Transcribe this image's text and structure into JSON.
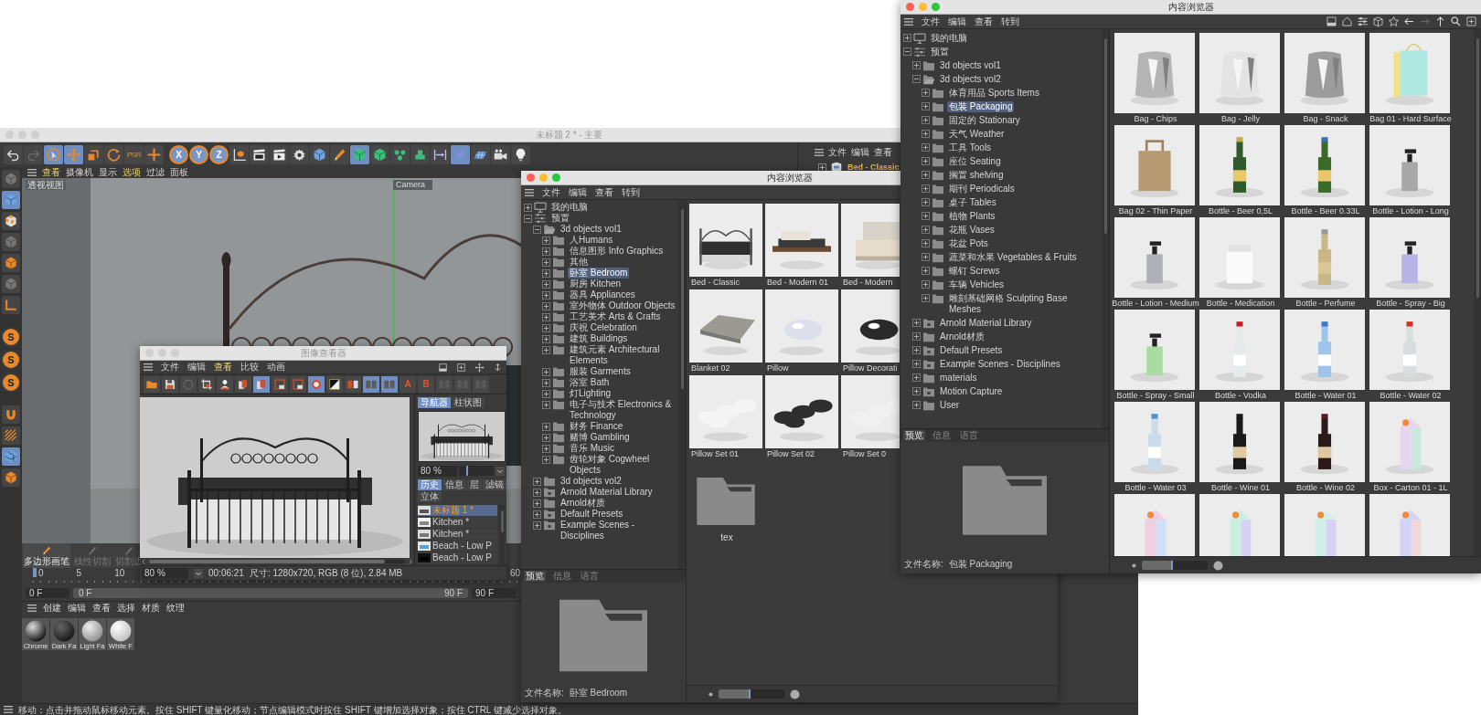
{
  "main_window": {
    "title": "未标题 2 * - 主要",
    "active": false,
    "axis_buttons": [
      {
        "label": "X",
        "on": true
      },
      {
        "label": "Y",
        "on": true
      },
      {
        "label": "Z",
        "on": true
      }
    ],
    "psr_label": "PSR",
    "viewport_menu": [
      {
        "label": "查看",
        "active": true
      },
      {
        "label": "摄像机",
        "active": false
      },
      {
        "label": "显示",
        "active": false
      },
      {
        "label": "选项",
        "active": true
      },
      {
        "label": "过滤",
        "active": false
      },
      {
        "label": "面板",
        "active": false
      }
    ],
    "viewport": {
      "view_name": "透视视图",
      "camera": "Camera"
    },
    "left_letter_buttons": [
      "S",
      "S",
      "S"
    ],
    "tool_palette": [
      {
        "label": "多边形画笔",
        "disabled": false
      },
      {
        "label": "线性切割",
        "disabled": true
      },
      {
        "label": "切割边",
        "disabled": true
      }
    ],
    "timeline": {
      "ticks": [
        "0",
        "5",
        "10"
      ],
      "end_tick": "60"
    },
    "frame_fields": {
      "start": "0 F",
      "range_start": "0 F",
      "range_end": "90 F",
      "end": "90 F",
      "level": 1
    },
    "object_manager": {
      "menu": [
        "文件",
        "编辑",
        "查看"
      ],
      "object": "Bed - Classic"
    },
    "material_manager": {
      "menu": [
        "创建",
        "编辑",
        "查看",
        "选择",
        "材质",
        "纹理"
      ],
      "materials": [
        "Chrome",
        "Dark Fa",
        "Light Fa",
        "White F"
      ]
    },
    "status_bar": "移动：点击并拖动鼠标移动元素。按住 SHIFT 键量化移动；节点编辑模式时按住 SHIFT 键增加选择对象；按住 CTRL 键减少选择对象。"
  },
  "image_viewer": {
    "title": "图像查看器",
    "active": false,
    "menu": [
      {
        "label": "文件",
        "active": false
      },
      {
        "label": "编辑",
        "active": false
      },
      {
        "label": "查看",
        "active": true
      },
      {
        "label": "比较",
        "active": false
      },
      {
        "label": "动画",
        "active": false
      }
    ],
    "compare_buttons": [
      "A",
      "B"
    ],
    "panel_tabs": [
      {
        "label": "导航器",
        "selected": true
      },
      {
        "label": "柱状图",
        "selected": false
      }
    ],
    "zoom_slider": {
      "value": "80 %",
      "level": 0.2
    },
    "history_tabs": [
      {
        "label": "历史",
        "selected": true
      },
      {
        "label": "信息",
        "selected": false
      },
      {
        "label": "层",
        "selected": false
      },
      {
        "label": "滤镜",
        "selected": false
      },
      {
        "label": "立体",
        "selected": false
      }
    ],
    "history": [
      {
        "label": "未标题 1 *",
        "selected": true
      },
      {
        "label": "Kitchen *",
        "selected": false
      },
      {
        "label": "Kitchen *",
        "selected": false
      },
      {
        "label": "Beach - Low P",
        "selected": false
      },
      {
        "label": "Beach - Low P",
        "selected": false
      }
    ],
    "status": {
      "zoom": "80 %",
      "time": "00:06:21",
      "info": "尺寸: 1280x720, RGB (8 位), 2.84 MB"
    }
  },
  "content_browsers": [
    {
      "title": "内容浏览器",
      "active": true,
      "menu": [
        "文件",
        "编辑",
        "查看",
        "转到"
      ],
      "tree": [
        {
          "label": "我的电脑",
          "kind": "computer",
          "expanded": false,
          "selected": false
        },
        {
          "label": "预置",
          "kind": "presets",
          "expanded": true,
          "selected": false,
          "children": [
            {
              "label": "3d objects vol1",
              "kind": "folder",
              "expanded": true,
              "selected": false,
              "children": [
                {
                  "label": "人Humans",
                  "kind": "folder",
                  "expanded": false,
                  "selected": false
                },
                {
                  "label": "信息图形 Info Graphics",
                  "kind": "folder",
                  "expanded": false,
                  "selected": false
                },
                {
                  "label": "其他",
                  "kind": "folder",
                  "expanded": false,
                  "selected": false
                },
                {
                  "label": "卧室 Bedroom",
                  "kind": "folder",
                  "expanded": false,
                  "selected": true
                },
                {
                  "label": "厨房 Kitchen",
                  "kind": "folder",
                  "expanded": false,
                  "selected": false
                },
                {
                  "label": "器具 Appliances",
                  "kind": "folder",
                  "expanded": false,
                  "selected": false
                },
                {
                  "label": "室外物体 Outdoor Objects",
                  "kind": "folder",
                  "expanded": false,
                  "selected": false
                },
                {
                  "label": "工艺美术 Arts & Crafts",
                  "kind": "folder",
                  "expanded": false,
                  "selected": false
                },
                {
                  "label": "庆祝 Celebration",
                  "kind": "folder",
                  "expanded": false,
                  "selected": false
                },
                {
                  "label": "建筑 Buildings",
                  "kind": "folder",
                  "expanded": false,
                  "selected": false
                },
                {
                  "label": "建筑元素 Architectural Elements",
                  "kind": "folder",
                  "expanded": false,
                  "selected": false
                },
                {
                  "label": "服装 Garments",
                  "kind": "folder",
                  "expanded": false,
                  "selected": false
                },
                {
                  "label": "浴室 Bath",
                  "kind": "folder",
                  "expanded": false,
                  "selected": false
                },
                {
                  "label": "灯Lighting",
                  "kind": "folder",
                  "expanded": false,
                  "selected": false
                },
                {
                  "label": "电子与技术 Electronics & Technology",
                  "kind": "folder",
                  "expanded": false,
                  "selected": false
                },
                {
                  "label": "财务 Finance",
                  "kind": "folder",
                  "expanded": false,
                  "selected": false
                },
                {
                  "label": "赌博 Gambling",
                  "kind": "folder",
                  "expanded": false,
                  "selected": false
                },
                {
                  "label": "音乐 Music",
                  "kind": "folder",
                  "expanded": false,
                  "selected": false
                },
                {
                  "label": "齿轮对象 Cogwheel Objects",
                  "kind": "folder",
                  "expanded": false,
                  "selected": false
                }
              ]
            },
            {
              "label": "3d objects vol2",
              "kind": "folder",
              "expanded": false,
              "selected": false
            },
            {
              "label": "Arnold Material Library",
              "kind": "library",
              "expanded": false,
              "selected": false
            },
            {
              "label": "Arnold材质",
              "kind": "folder",
              "expanded": false,
              "selected": false
            },
            {
              "label": "Default Presets",
              "kind": "library",
              "expanded": false,
              "selected": false
            },
            {
              "label": "Example Scenes - Disciplines",
              "kind": "library",
              "expanded": false,
              "selected": false
            }
          ]
        }
      ],
      "grid": [
        {
          "kind": "thumbnail",
          "label": "Bed - Classic"
        },
        {
          "kind": "thumbnail",
          "label": "Bed - Modern 01"
        },
        {
          "kind": "thumbnail",
          "label": "Bed - Modern"
        },
        {
          "kind": "thumbnail",
          "label": "Blanket 02"
        },
        {
          "kind": "thumbnail",
          "label": "Pillow"
        },
        {
          "kind": "thumbnail",
          "label": "Pillow Decorati"
        },
        {
          "kind": "thumbnail",
          "label": "Pillow Set 01"
        },
        {
          "kind": "thumbnail",
          "label": "Pillow Set 02"
        },
        {
          "kind": "thumbnail",
          "label": "Pillow Set 0"
        },
        {
          "kind": "folder",
          "label": "tex"
        }
      ],
      "preview_tabs": [
        {
          "label": "预览",
          "selected": true
        },
        {
          "label": "信息",
          "selected": false
        },
        {
          "label": "语言",
          "selected": false
        }
      ],
      "file_name_label": "文件名称:",
      "file_name": "卧室 Bedroom",
      "zoom_slider": {
        "level": 0.48
      }
    },
    {
      "title": "内容浏览器",
      "active": true,
      "menu": [
        "文件",
        "编辑",
        "查看",
        "转到"
      ],
      "toolbar_icons": true,
      "tree": [
        {
          "label": "我的电脑",
          "kind": "computer",
          "expanded": false,
          "selected": false
        },
        {
          "label": "预置",
          "kind": "presets",
          "expanded": true,
          "selected": false,
          "children": [
            {
              "label": "3d objects vol1",
              "kind": "folder",
              "expanded": false,
              "selected": false
            },
            {
              "label": "3d objects vol2",
              "kind": "folder",
              "expanded": true,
              "selected": false,
              "children": [
                {
                  "label": "体育用品 Sports Items",
                  "kind": "folder",
                  "expanded": false,
                  "selected": false
                },
                {
                  "label": "包装 Packaging",
                  "kind": "folder",
                  "expanded": false,
                  "selected": true
                },
                {
                  "label": "固定的 Stationary",
                  "kind": "folder",
                  "expanded": false,
                  "selected": false
                },
                {
                  "label": "天气 Weather",
                  "kind": "folder",
                  "expanded": false,
                  "selected": false
                },
                {
                  "label": "工具 Tools",
                  "kind": "folder",
                  "expanded": false,
                  "selected": false
                },
                {
                  "label": "座位 Seating",
                  "kind": "folder",
                  "expanded": false,
                  "selected": false
                },
                {
                  "label": "搁置 shelving",
                  "kind": "folder",
                  "expanded": false,
                  "selected": false
                },
                {
                  "label": "期刊 Periodicals",
                  "kind": "folder",
                  "expanded": false,
                  "selected": false
                },
                {
                  "label": "桌子 Tables",
                  "kind": "folder",
                  "expanded": false,
                  "selected": false
                },
                {
                  "label": "植物 Plants",
                  "kind": "folder",
                  "expanded": false,
                  "selected": false
                },
                {
                  "label": "花瓶 Vases",
                  "kind": "folder",
                  "expanded": false,
                  "selected": false
                },
                {
                  "label": "花盆 Pots",
                  "kind": "folder",
                  "expanded": false,
                  "selected": false
                },
                {
                  "label": "蔬菜和水果 Vegetables & Fruits",
                  "kind": "folder",
                  "expanded": false,
                  "selected": false
                },
                {
                  "label": "螺钉 Screws",
                  "kind": "folder",
                  "expanded": false,
                  "selected": false
                },
                {
                  "label": "车辆 Vehicles",
                  "kind": "folder",
                  "expanded": false,
                  "selected": false
                },
                {
                  "label": "雕刻基础网格 Sculpting Base Meshes",
                  "kind": "folder",
                  "expanded": false,
                  "selected": false
                }
              ]
            },
            {
              "label": "Arnold Material Library",
              "kind": "library",
              "expanded": false,
              "selected": false
            },
            {
              "label": "Arnold材质",
              "kind": "folder",
              "expanded": false,
              "selected": false
            },
            {
              "label": "Default Presets",
              "kind": "library",
              "expanded": false,
              "selected": false
            },
            {
              "label": "Example Scenes - Disciplines",
              "kind": "library",
              "expanded": false,
              "selected": false
            },
            {
              "label": "materials",
              "kind": "folder",
              "expanded": false,
              "selected": false
            },
            {
              "label": "Motion Capture",
              "kind": "library",
              "expanded": false,
              "selected": false
            },
            {
              "label": "User",
              "kind": "folder",
              "expanded": false,
              "selected": false
            }
          ]
        }
      ],
      "grid": [
        {
          "kind": "thumbnail",
          "label": "Bag - Chips"
        },
        {
          "kind": "thumbnail",
          "label": "Bag - Jelly"
        },
        {
          "kind": "thumbnail",
          "label": "Bag - Snack"
        },
        {
          "kind": "thumbnail",
          "label": "Bag 01 - Hard Surface"
        },
        {
          "kind": "thumbnail",
          "label": "Bag 02 - Thin Paper"
        },
        {
          "kind": "thumbnail",
          "label": "Bottle - Beer 0,5L"
        },
        {
          "kind": "thumbnail",
          "label": "Bottle - Beer 0.33L"
        },
        {
          "kind": "thumbnail",
          "label": "Bottle - Lotion - Long"
        },
        {
          "kind": "thumbnail",
          "label": "Bottle - Lotion - Medium"
        },
        {
          "kind": "thumbnail",
          "label": "Bottle - Medication"
        },
        {
          "kind": "thumbnail",
          "label": "Bottle - Perfume"
        },
        {
          "kind": "thumbnail",
          "label": "Bottle - Spray - Big"
        },
        {
          "kind": "thumbnail",
          "label": "Bottle - Spray - Small"
        },
        {
          "kind": "thumbnail",
          "label": "Bottle - Vodka"
        },
        {
          "kind": "thumbnail",
          "label": "Bottle - Water 01"
        },
        {
          "kind": "thumbnail",
          "label": "Bottle - Water 02"
        },
        {
          "kind": "thumbnail",
          "label": "Bottle - Water 03"
        },
        {
          "kind": "thumbnail",
          "label": "Bottle - Wine 01"
        },
        {
          "kind": "thumbnail",
          "label": "Bottle - Wine 02"
        },
        {
          "kind": "thumbnail",
          "label": "Box - Carton 01 - 1L"
        },
        {
          "kind": "thumbnail"
        },
        {
          "kind": "thumbnail"
        },
        {
          "kind": "thumbnail"
        },
        {
          "kind": "thumbnail"
        }
      ],
      "preview_tabs": [
        {
          "label": "预览",
          "selected": true
        },
        {
          "label": "信息",
          "selected": false
        },
        {
          "label": "语言",
          "selected": false
        }
      ],
      "file_name_label": "文件名称:",
      "file_name": "包装 Packaging",
      "zoom_slider": {
        "level": 0.47
      }
    }
  ]
}
